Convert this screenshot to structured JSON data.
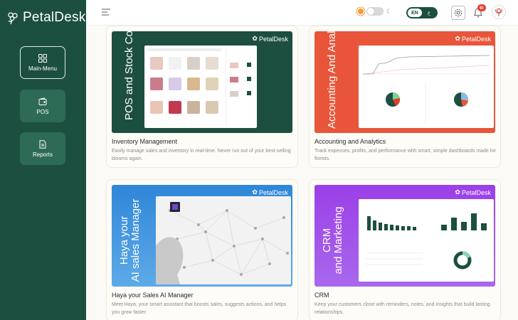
{
  "brand": {
    "name": "PetalDesk"
  },
  "sidebar": {
    "items": [
      {
        "label": "Main-Menu",
        "icon": "grid-icon",
        "active": true
      },
      {
        "label": "POS",
        "icon": "wallet-icon",
        "active": false
      },
      {
        "label": "Reports",
        "icon": "document-icon",
        "active": false
      }
    ]
  },
  "header": {
    "language": {
      "selected": "EN",
      "other": "ع"
    },
    "notifications": {
      "count": "6!"
    },
    "colors": {
      "primary": "#1c4f3f",
      "badge": "#e23a2f",
      "sun": "#f39a3a"
    }
  },
  "cards": [
    {
      "image_caption": "POS and Stock Controls",
      "image_color": "#1c4f3f",
      "title": "Inventory Management",
      "description": "Easily manage sales and inventory in real-time. Never run out of your best-selling blooms again."
    },
    {
      "image_caption": "Accounting And Analytics",
      "image_color": "#e8553a",
      "title": "Accounting and Analytics",
      "description": "Track expenses, profits, and performance with smart, simple dashboards made for florists."
    },
    {
      "image_caption_line1": "Haya your",
      "image_caption_line2": "AI sales Manager",
      "image_color": "#2f86d8",
      "title": "Haya your Sales AI Manager",
      "description": "Meet Haya, your smart assistant that boosts sales, suggests actions, and helps you grow faster."
    },
    {
      "image_caption_line1": "CRM",
      "image_caption_line2": "and Marketing",
      "image_color": "#9b3fe8",
      "title": "CRM",
      "description": "Keep your customers close with reminders, notes, and insights that build lasting relationships."
    }
  ]
}
